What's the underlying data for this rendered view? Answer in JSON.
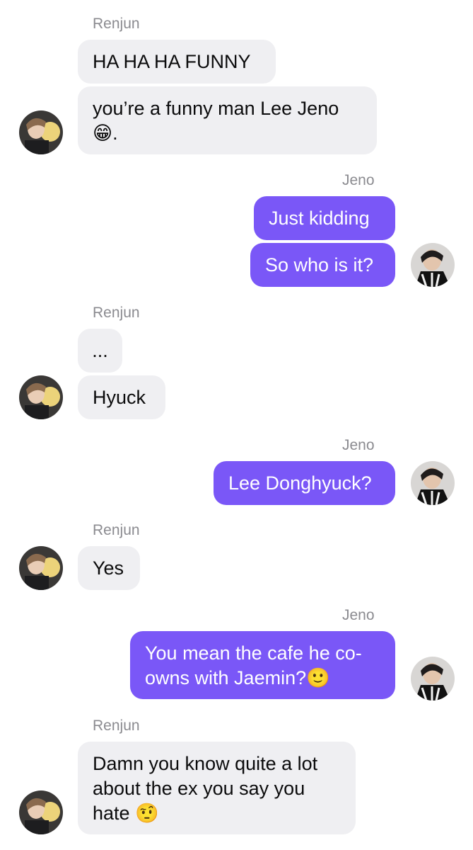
{
  "messages": [
    {
      "sender": "Renjun",
      "text": "HA HA HA FUNNY"
    },
    {
      "sender": "Renjun",
      "text": "you’re a funny man Lee Jeno",
      "line2": "😁."
    },
    {
      "sender": "Jeno",
      "text": "Just kidding"
    },
    {
      "sender": "Jeno",
      "text": "So who is it?"
    },
    {
      "sender": "Renjun",
      "text": "..."
    },
    {
      "sender": "Renjun",
      "text": "Hyuck"
    },
    {
      "sender": "Jeno",
      "text": "Lee Donghyuck?"
    },
    {
      "sender": "Renjun",
      "text": "Yes"
    },
    {
      "sender": "Jeno",
      "text": "You mean the cafe he co-",
      "line2": "owns with Jaemin?🙂"
    },
    {
      "sender": "Renjun",
      "text": "Damn you know quite a lot",
      "line2": "about the ex you say you",
      "line3": "hate 🤨"
    }
  ],
  "names": {
    "renjun": "Renjun",
    "jeno": "Jeno"
  },
  "colors": {
    "incoming_bubble": "#efeff2",
    "outgoing_bubble": "#7a57f7",
    "name_label": "#8b8b90"
  }
}
